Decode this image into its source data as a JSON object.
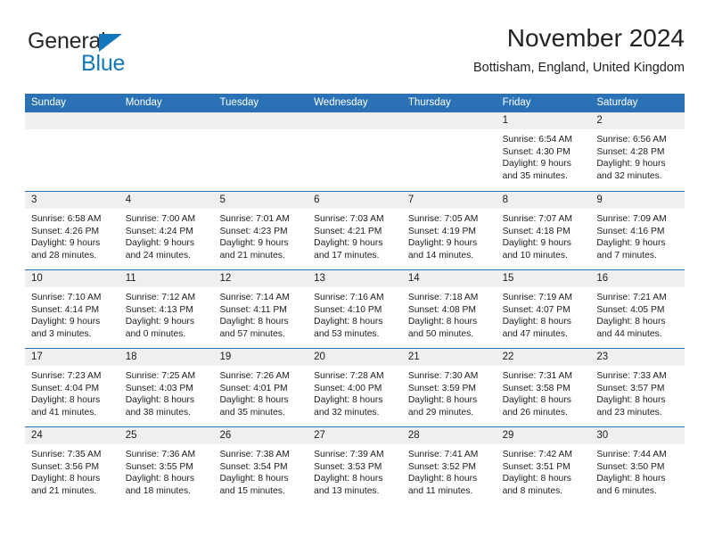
{
  "brand": {
    "name_part1": "General",
    "name_part2": "Blue",
    "triangle_color": "#1277bd",
    "text_color": "#282828"
  },
  "header": {
    "title": "November 2024",
    "subtitle": "Bottisham, England, United Kingdom"
  },
  "theme": {
    "header_blue": "#2a72b5",
    "day_band_gray": "#efefef",
    "text": "#1c1c1c",
    "row_separator": "#2a72b5"
  },
  "weekdays": [
    "Sunday",
    "Monday",
    "Tuesday",
    "Wednesday",
    "Thursday",
    "Friday",
    "Saturday"
  ],
  "weeks": [
    [
      {
        "day": "",
        "lines": []
      },
      {
        "day": "",
        "lines": []
      },
      {
        "day": "",
        "lines": []
      },
      {
        "day": "",
        "lines": []
      },
      {
        "day": "",
        "lines": []
      },
      {
        "day": "1",
        "lines": [
          "Sunrise: 6:54 AM",
          "Sunset: 4:30 PM",
          "Daylight: 9 hours",
          "and 35 minutes."
        ]
      },
      {
        "day": "2",
        "lines": [
          "Sunrise: 6:56 AM",
          "Sunset: 4:28 PM",
          "Daylight: 9 hours",
          "and 32 minutes."
        ]
      }
    ],
    [
      {
        "day": "3",
        "lines": [
          "Sunrise: 6:58 AM",
          "Sunset: 4:26 PM",
          "Daylight: 9 hours",
          "and 28 minutes."
        ]
      },
      {
        "day": "4",
        "lines": [
          "Sunrise: 7:00 AM",
          "Sunset: 4:24 PM",
          "Daylight: 9 hours",
          "and 24 minutes."
        ]
      },
      {
        "day": "5",
        "lines": [
          "Sunrise: 7:01 AM",
          "Sunset: 4:23 PM",
          "Daylight: 9 hours",
          "and 21 minutes."
        ]
      },
      {
        "day": "6",
        "lines": [
          "Sunrise: 7:03 AM",
          "Sunset: 4:21 PM",
          "Daylight: 9 hours",
          "and 17 minutes."
        ]
      },
      {
        "day": "7",
        "lines": [
          "Sunrise: 7:05 AM",
          "Sunset: 4:19 PM",
          "Daylight: 9 hours",
          "and 14 minutes."
        ]
      },
      {
        "day": "8",
        "lines": [
          "Sunrise: 7:07 AM",
          "Sunset: 4:18 PM",
          "Daylight: 9 hours",
          "and 10 minutes."
        ]
      },
      {
        "day": "9",
        "lines": [
          "Sunrise: 7:09 AM",
          "Sunset: 4:16 PM",
          "Daylight: 9 hours",
          "and 7 minutes."
        ]
      }
    ],
    [
      {
        "day": "10",
        "lines": [
          "Sunrise: 7:10 AM",
          "Sunset: 4:14 PM",
          "Daylight: 9 hours",
          "and 3 minutes."
        ]
      },
      {
        "day": "11",
        "lines": [
          "Sunrise: 7:12 AM",
          "Sunset: 4:13 PM",
          "Daylight: 9 hours",
          "and 0 minutes."
        ]
      },
      {
        "day": "12",
        "lines": [
          "Sunrise: 7:14 AM",
          "Sunset: 4:11 PM",
          "Daylight: 8 hours",
          "and 57 minutes."
        ]
      },
      {
        "day": "13",
        "lines": [
          "Sunrise: 7:16 AM",
          "Sunset: 4:10 PM",
          "Daylight: 8 hours",
          "and 53 minutes."
        ]
      },
      {
        "day": "14",
        "lines": [
          "Sunrise: 7:18 AM",
          "Sunset: 4:08 PM",
          "Daylight: 8 hours",
          "and 50 minutes."
        ]
      },
      {
        "day": "15",
        "lines": [
          "Sunrise: 7:19 AM",
          "Sunset: 4:07 PM",
          "Daylight: 8 hours",
          "and 47 minutes."
        ]
      },
      {
        "day": "16",
        "lines": [
          "Sunrise: 7:21 AM",
          "Sunset: 4:05 PM",
          "Daylight: 8 hours",
          "and 44 minutes."
        ]
      }
    ],
    [
      {
        "day": "17",
        "lines": [
          "Sunrise: 7:23 AM",
          "Sunset: 4:04 PM",
          "Daylight: 8 hours",
          "and 41 minutes."
        ]
      },
      {
        "day": "18",
        "lines": [
          "Sunrise: 7:25 AM",
          "Sunset: 4:03 PM",
          "Daylight: 8 hours",
          "and 38 minutes."
        ]
      },
      {
        "day": "19",
        "lines": [
          "Sunrise: 7:26 AM",
          "Sunset: 4:01 PM",
          "Daylight: 8 hours",
          "and 35 minutes."
        ]
      },
      {
        "day": "20",
        "lines": [
          "Sunrise: 7:28 AM",
          "Sunset: 4:00 PM",
          "Daylight: 8 hours",
          "and 32 minutes."
        ]
      },
      {
        "day": "21",
        "lines": [
          "Sunrise: 7:30 AM",
          "Sunset: 3:59 PM",
          "Daylight: 8 hours",
          "and 29 minutes."
        ]
      },
      {
        "day": "22",
        "lines": [
          "Sunrise: 7:31 AM",
          "Sunset: 3:58 PM",
          "Daylight: 8 hours",
          "and 26 minutes."
        ]
      },
      {
        "day": "23",
        "lines": [
          "Sunrise: 7:33 AM",
          "Sunset: 3:57 PM",
          "Daylight: 8 hours",
          "and 23 minutes."
        ]
      }
    ],
    [
      {
        "day": "24",
        "lines": [
          "Sunrise: 7:35 AM",
          "Sunset: 3:56 PM",
          "Daylight: 8 hours",
          "and 21 minutes."
        ]
      },
      {
        "day": "25",
        "lines": [
          "Sunrise: 7:36 AM",
          "Sunset: 3:55 PM",
          "Daylight: 8 hours",
          "and 18 minutes."
        ]
      },
      {
        "day": "26",
        "lines": [
          "Sunrise: 7:38 AM",
          "Sunset: 3:54 PM",
          "Daylight: 8 hours",
          "and 15 minutes."
        ]
      },
      {
        "day": "27",
        "lines": [
          "Sunrise: 7:39 AM",
          "Sunset: 3:53 PM",
          "Daylight: 8 hours",
          "and 13 minutes."
        ]
      },
      {
        "day": "28",
        "lines": [
          "Sunrise: 7:41 AM",
          "Sunset: 3:52 PM",
          "Daylight: 8 hours",
          "and 11 minutes."
        ]
      },
      {
        "day": "29",
        "lines": [
          "Sunrise: 7:42 AM",
          "Sunset: 3:51 PM",
          "Daylight: 8 hours",
          "and 8 minutes."
        ]
      },
      {
        "day": "30",
        "lines": [
          "Sunrise: 7:44 AM",
          "Sunset: 3:50 PM",
          "Daylight: 8 hours",
          "and 6 minutes."
        ]
      }
    ]
  ]
}
